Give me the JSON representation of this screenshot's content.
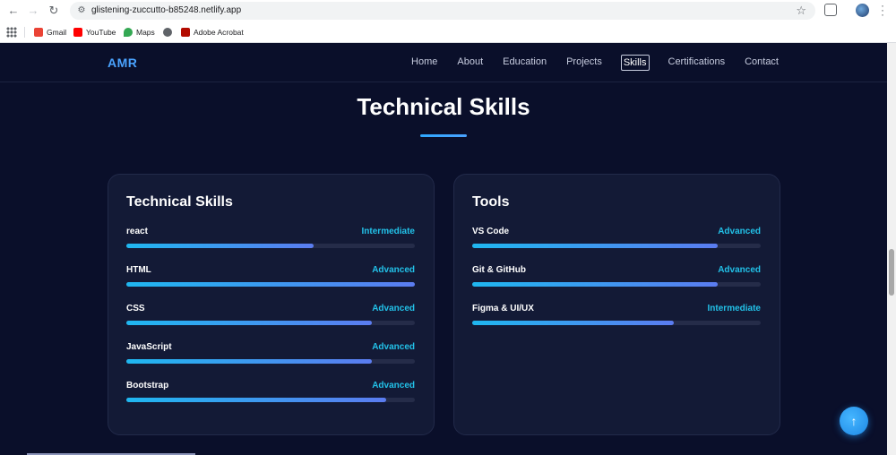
{
  "browser": {
    "url": "glistening-zuccutto-b85248.netlify.app",
    "bookmarks": [
      {
        "label": "Gmail",
        "color": "#ea4335"
      },
      {
        "label": "YouTube",
        "color": "#ff0000"
      },
      {
        "label": "Maps",
        "color": "#34a853"
      },
      {
        "label": "",
        "color": "#5f6368"
      },
      {
        "label": "Adobe Acrobat",
        "color": "#b30b00"
      }
    ]
  },
  "site": {
    "logo": "AMR",
    "nav": [
      "Home",
      "About",
      "Education",
      "Projects",
      "Skills",
      "Certifications",
      "Contact"
    ],
    "active_nav": "Skills",
    "section_title": "Technical Skills",
    "accent_color": "#22c1e8"
  },
  "cards": [
    {
      "title": "Technical Skills",
      "skills": [
        {
          "name": "react",
          "level": "Intermediate",
          "progress": 0.65
        },
        {
          "name": "HTML",
          "level": "Advanced",
          "progress": 1.0
        },
        {
          "name": "CSS",
          "level": "Advanced",
          "progress": 0.85
        },
        {
          "name": "JavaScript",
          "level": "Advanced",
          "progress": 0.85
        },
        {
          "name": "Bootstrap",
          "level": "Advanced",
          "progress": 0.9
        }
      ]
    },
    {
      "title": "Tools",
      "skills": [
        {
          "name": "VS Code",
          "level": "Advanced",
          "progress": 0.85
        },
        {
          "name": "Git & GitHub",
          "level": "Advanced",
          "progress": 0.85
        },
        {
          "name": "Figma & UI/UX",
          "level": "Intermediate",
          "progress": 0.7
        }
      ]
    }
  ]
}
